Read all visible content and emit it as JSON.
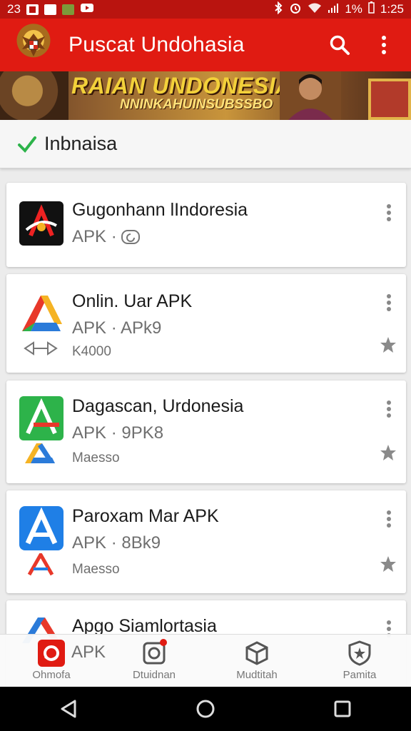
{
  "status_bar": {
    "left_text": "23",
    "battery": "1%",
    "time": "1:25"
  },
  "app_bar": {
    "title": "Puscat Undohasia",
    "logo_icon": "garuda-emblem-icon",
    "search_icon": "search-icon",
    "menu_icon": "more-vert-icon"
  },
  "banner": {
    "line1": "RAIAN UNDONESIAI",
    "line2": "NNINKAHUINSUBSSBO"
  },
  "filter": {
    "check_icon": "check-icon",
    "label": "Inbnaisa"
  },
  "apps": [
    {
      "title": "Gugonhann lIndoresia",
      "meta": "APK ·",
      "sub": "",
      "icon": "app-icon-dark"
    },
    {
      "title": "Onlin. Uar APK",
      "meta": "APK · APk9",
      "sub": "K4000",
      "icon": "app-icon-multicolor"
    },
    {
      "title": "Dagascan, Urdonesia",
      "meta": "APK · 9PK8",
      "sub": "Maesso",
      "icon": "app-icon-green"
    },
    {
      "title": "Paroxam Mar APK",
      "meta": "APK · 8Bk9",
      "sub": "Maesso",
      "icon": "app-icon-blue"
    },
    {
      "title": "Apgo Siamlortasia",
      "meta": "APK",
      "sub": "",
      "icon": "app-icon-partial"
    }
  ],
  "bottom_nav": [
    {
      "label": "Ohmofa",
      "icon": "home-app-icon"
    },
    {
      "label": "Dtuidnan",
      "icon": "instagram-icon"
    },
    {
      "label": "Mudtitah",
      "icon": "cube-icon"
    },
    {
      "label": "Pamita",
      "icon": "shield-icon"
    }
  ],
  "colors": {
    "app_bar": "#e01b12",
    "status_bar": "#b9140f",
    "accent_check": "#2db34a"
  }
}
